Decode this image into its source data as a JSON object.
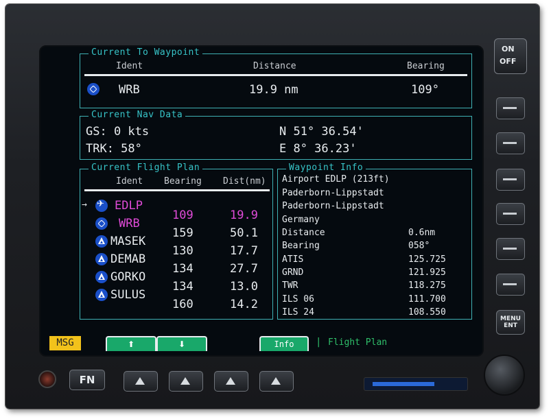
{
  "to_waypoint": {
    "title": "Current To Waypoint",
    "col_ident": "Ident",
    "col_distance": "Distance",
    "col_bearing": "Bearing",
    "ident": "WRB",
    "distance": "19.9 nm",
    "bearing": "109°",
    "icon": "vor-icon"
  },
  "nav_data": {
    "title": "Current Nav Data",
    "gs": "GS: 0 kts",
    "trk": "TRK: 58°",
    "lat": "N 51° 36.54'",
    "lon": "E 8° 36.23'"
  },
  "flight_plan": {
    "title": "Current Flight Plan",
    "col_ident": "Ident",
    "col_bearing": "Bearing",
    "col_dist": "Dist(nm)",
    "rows": [
      {
        "ident": "EDLP",
        "bearing": "",
        "dist": "",
        "type": "airport",
        "active": true,
        "arrow": true
      },
      {
        "ident": "WRB",
        "bearing": "109",
        "dist": "19.9",
        "type": "vor",
        "active": true
      },
      {
        "ident": "MASEK",
        "bearing": "159",
        "dist": "50.1",
        "type": "intersection"
      },
      {
        "ident": "DEMAB",
        "bearing": "130",
        "dist": "17.7",
        "type": "intersection"
      },
      {
        "ident": "GORKO",
        "bearing": "134",
        "dist": "27.7",
        "type": "intersection"
      },
      {
        "ident": "SULUS",
        "bearing": "134",
        "dist": "13.0",
        "type": "intersection"
      },
      {
        "ident": "",
        "bearing": "160",
        "dist": "14.2",
        "type": "none"
      }
    ]
  },
  "waypoint_info": {
    "title": "Waypoint Info",
    "lines": [
      "Airport EDLP (213ft)",
      "Paderborn-Lippstadt",
      "Paderborn-Lippstadt",
      "Germany"
    ],
    "fields": [
      {
        "label": "Distance",
        "value": "0.6nm"
      },
      {
        "label": "Bearing",
        "value": "058°"
      },
      {
        "label": "ATIS",
        "value": "125.725"
      },
      {
        "label": "GRND",
        "value": "121.925"
      },
      {
        "label": "TWR",
        "value": "118.275"
      },
      {
        "label": "ILS 06",
        "value": "111.700"
      },
      {
        "label": "ILS 24",
        "value": "108.550"
      }
    ]
  },
  "softkeys": {
    "msg": "MSG",
    "info": "Info",
    "page_label": "Flight Plan",
    "separator": "|",
    "up_icon": "up-arrow-icon",
    "down_icon": "down-arrow-icon"
  },
  "hardware": {
    "on_label": "ON",
    "off_label": "OFF",
    "menu_label": "MENU",
    "ent_label": "ENT",
    "fn_label": "FN"
  },
  "colors": {
    "panel_border": "#3fb2b5",
    "title": "#37c4c8",
    "active_leg": "#e04bd8",
    "waypoint_icon": "#1a4fc8",
    "softkey": "#19a86a",
    "msg": "#f2c21b"
  }
}
